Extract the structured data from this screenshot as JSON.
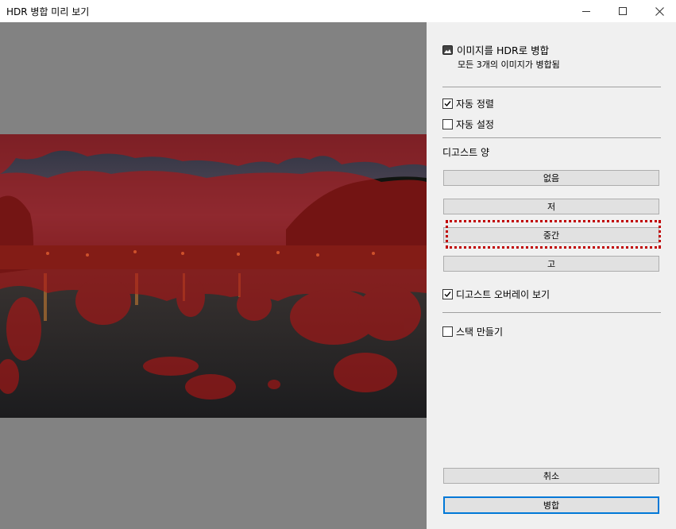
{
  "window": {
    "title": "HDR 병합 미리 보기",
    "controls": [
      "minimize-icon",
      "maximize-icon",
      "close-icon"
    ]
  },
  "panel": {
    "header_title": "이미지를 HDR로 병합",
    "header_subtitle": "모든 3개의 이미지가 병합됨",
    "auto_align": {
      "label": "자동 정렬",
      "checked": true
    },
    "auto_settings": {
      "label": "자동 설정",
      "checked": false
    },
    "deghost_label": "디고스트 양",
    "deghost_options": [
      "없음",
      "저",
      "중간",
      "고"
    ],
    "deghost_selected": "중간",
    "show_overlay": {
      "label": "디고스트 오버레이 보기",
      "checked": true
    },
    "create_stack": {
      "label": "스택 만들기",
      "checked": false
    },
    "cancel_label": "취소",
    "merge_label": "병합"
  },
  "colors": {
    "focus_ring": "#c00000",
    "default_button_border": "#0078d7",
    "overlay": "#b01515"
  }
}
